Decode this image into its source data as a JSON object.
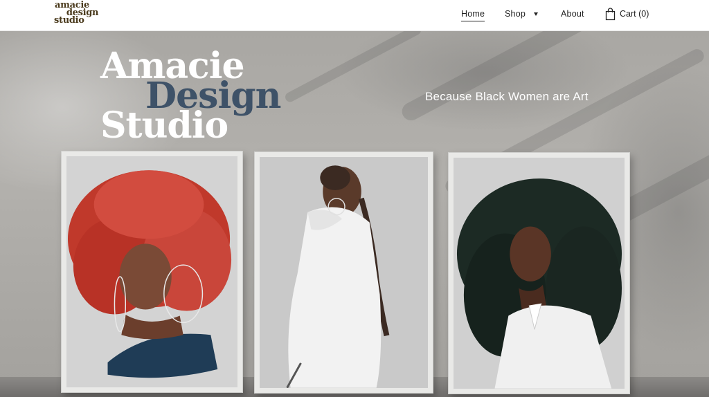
{
  "header": {
    "logo_lines": [
      "amacie",
      "design",
      "studio"
    ],
    "nav": {
      "home": "Home",
      "shop": "Shop",
      "about": "About",
      "cart": "Cart (0)"
    }
  },
  "hero": {
    "title_line1": "Amacie",
    "title_line2": "Design",
    "title_line3": "Studio",
    "tagline": "Because Black Women are Art"
  },
  "icons": {
    "cart": "shopping-bag-icon",
    "shop_dropdown": "caret-down-icon"
  },
  "colors": {
    "logo": "#4a3a1c",
    "title_accent": "#3e5268",
    "title_white": "#ffffff",
    "nav_text": "#222222"
  }
}
